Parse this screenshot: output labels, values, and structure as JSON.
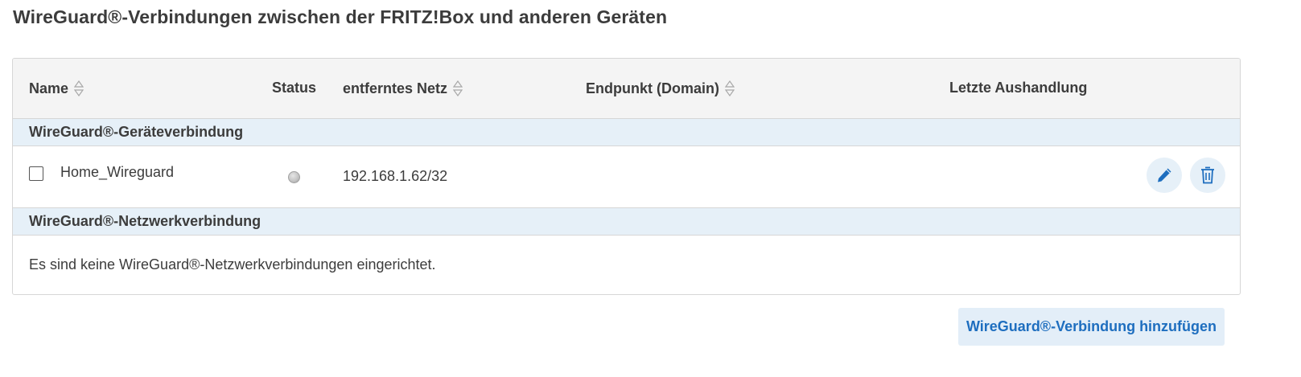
{
  "page": {
    "title": "WireGuard®-Verbindungen zwischen der FRITZ!Box und anderen Geräten"
  },
  "table": {
    "columns": [
      {
        "label": "Name",
        "sortable": true
      },
      {
        "label": "Status",
        "sortable": false
      },
      {
        "label": "entferntes Netz",
        "sortable": true
      },
      {
        "label": "Endpunkt (Domain)",
        "sortable": true
      },
      {
        "label": "Letzte Aushandlung",
        "sortable": false
      }
    ],
    "groups": [
      {
        "label": "WireGuard®-Geräteverbindung",
        "rows": [
          {
            "checked": false,
            "name": "Home_Wireguard",
            "status": "inactive",
            "remote_network": "192.168.1.62/32",
            "endpoint": "",
            "last_handshake": "",
            "actions": [
              "edit-icon",
              "trash-icon"
            ]
          }
        ]
      },
      {
        "label": "WireGuard®-Netzwerkverbindung",
        "empty_message": "Es sind keine WireGuard®-Netzwerkverbindungen eingerichtet."
      }
    ]
  },
  "actions": {
    "add_label": "WireGuard®-Verbindung hinzufügen"
  },
  "colors": {
    "accent": "#1e6ebf",
    "group_bg": "#e6f0f8",
    "header_bg": "#f4f4f4",
    "status_inactive": "#c2c2c2"
  }
}
